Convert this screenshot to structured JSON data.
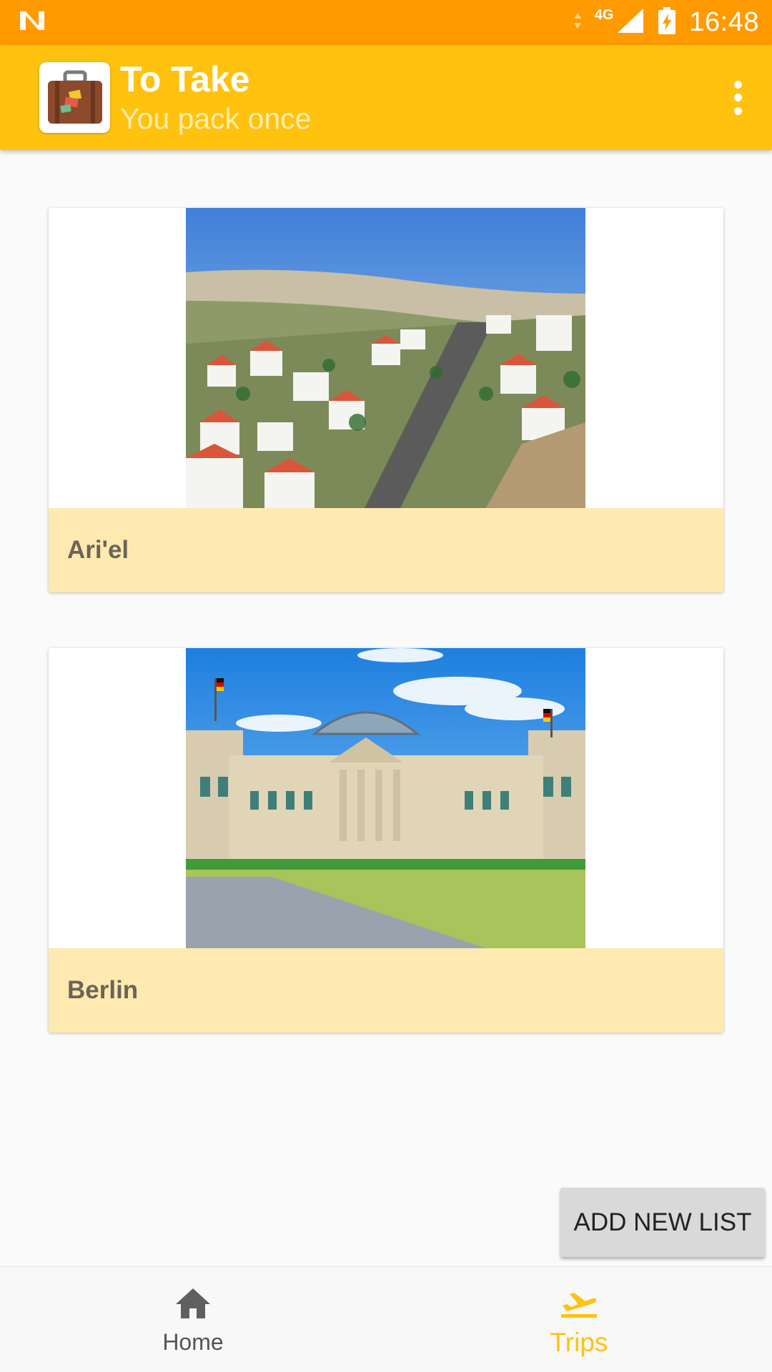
{
  "status_bar": {
    "time": "16:48",
    "network_type": "4G",
    "icons": [
      "notification-n-icon",
      "data-arrows-icon",
      "signal-icon",
      "battery-charging-icon"
    ]
  },
  "app_bar": {
    "title": "To Take",
    "subtitle": "You pack once",
    "logo_icon": "suitcase-icon",
    "menu_icon": "more-vert-icon"
  },
  "trips": [
    {
      "label": "Ari'el",
      "image_desc": "hillside town with white houses and red roofs"
    },
    {
      "label": "Berlin",
      "image_desc": "Reichstag building with glass dome"
    }
  ],
  "add_button": {
    "label": "ADD NEW LIST"
  },
  "bottom_nav": {
    "items": [
      {
        "label": "Home",
        "icon": "home-icon",
        "active": false
      },
      {
        "label": "Trips",
        "icon": "flight-takeoff-icon",
        "active": true
      }
    ]
  },
  "colors": {
    "status_bar": "#ff9a00",
    "app_bar": "#ffc20e",
    "card_footer": "#feeab0",
    "active_nav": "#ffc20e"
  }
}
